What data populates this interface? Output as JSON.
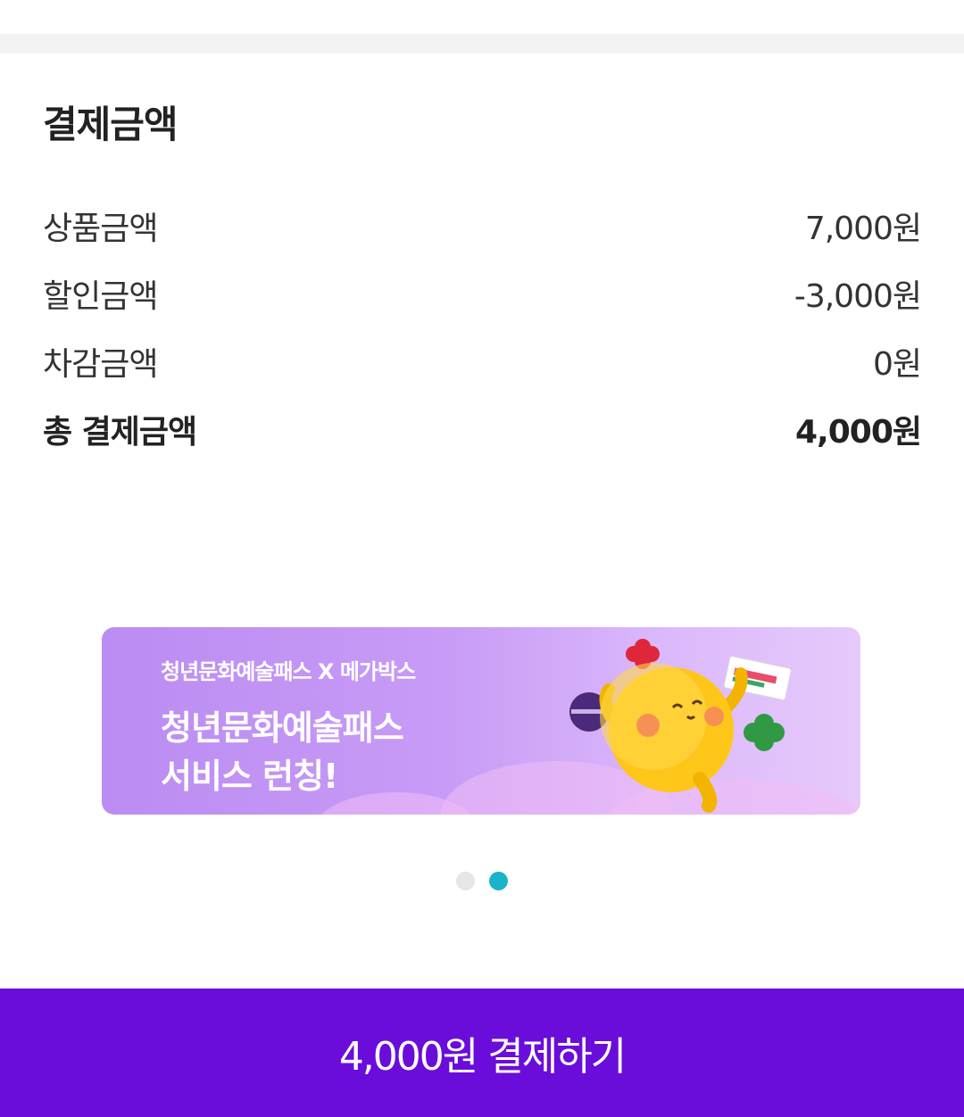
{
  "payment": {
    "title": "결제금액",
    "rows": [
      {
        "label": "상품금액",
        "value": "7,000원"
      },
      {
        "label": "할인금액",
        "value": "-3,000원"
      },
      {
        "label": "차감금액",
        "value": "0원"
      }
    ],
    "total": {
      "label": "총 결제금액",
      "value": "4,000원"
    }
  },
  "banner": {
    "subtitle": "청년문화예술패스 X 메가박스",
    "line1": "청년문화예술패스",
    "line2": "서비스 런칭!"
  },
  "carousel": {
    "total": 2,
    "active": 2
  },
  "pay_button": {
    "label": "4,000원 결제하기"
  },
  "colors": {
    "accent": "#6a0ddb",
    "indicator_active": "#1bb3c9",
    "indicator_inactive": "#e6e6e6"
  }
}
